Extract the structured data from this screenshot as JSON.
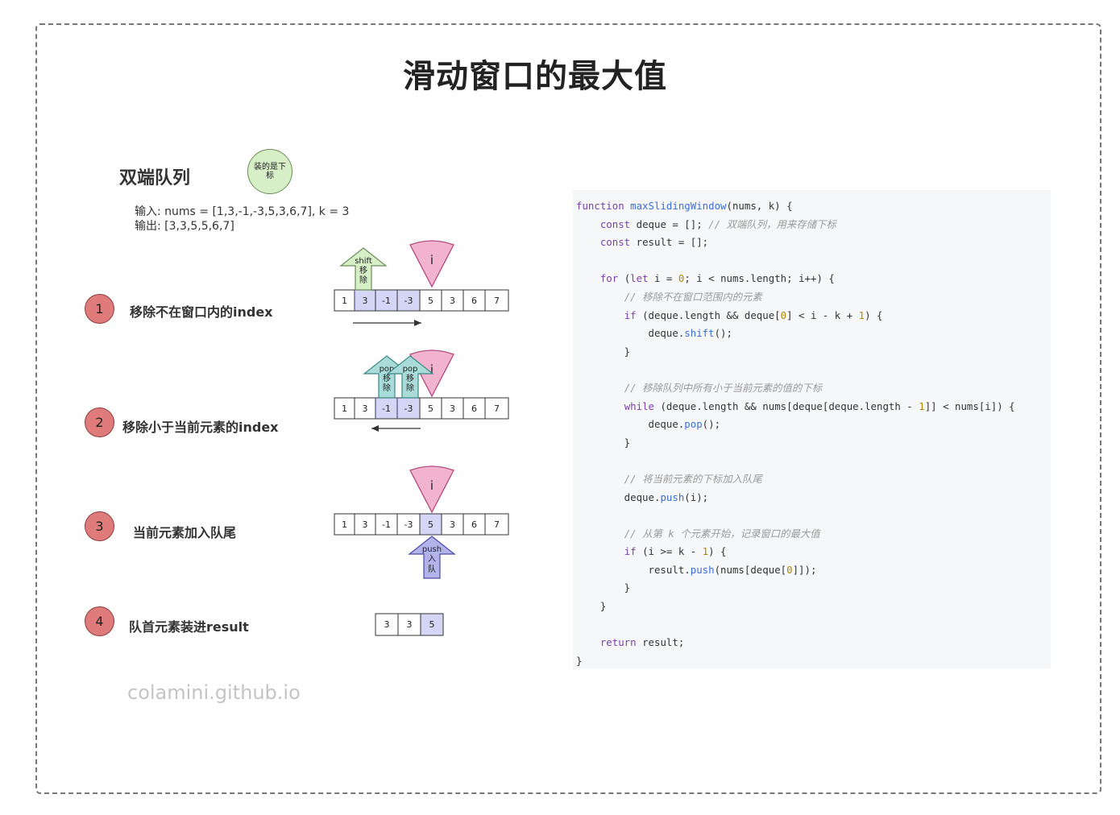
{
  "title": "滑动窗口的最大值",
  "subtitle": "双端队列",
  "badge": "装的是下标",
  "io": {
    "input": "输入: nums = [1,3,-1,-3,5,3,6,7], k = 3",
    "output": "输出: [3,3,5,5,6,7]"
  },
  "steps": [
    {
      "num": "1",
      "label": "移除不在窗口内的index"
    },
    {
      "num": "2",
      "label": "移除小于当前元素的index"
    },
    {
      "num": "3",
      "label": "当前元素加入队尾"
    },
    {
      "num": "4",
      "label": "队首元素装进result"
    }
  ],
  "array": [
    "1",
    "3",
    "-1",
    "-3",
    "5",
    "3",
    "6",
    "7"
  ],
  "pointer_label": "i",
  "arrows": {
    "shift": [
      "shift",
      "移",
      "除"
    ],
    "pop": [
      "pop",
      "移",
      "除"
    ],
    "push": [
      "push",
      "入",
      "队"
    ]
  },
  "result_cells": [
    "3",
    "3",
    "5"
  ],
  "watermark": "colamini.github.io",
  "colors": {
    "step_circle": "#e07b7b",
    "highlight": "#d5d5f5",
    "pointer": "#f2b3cf",
    "shift_arrow": "#d6efc6",
    "pop_arrow": "#a9dbd8",
    "push_arrow": "#b3b3ec"
  },
  "code": [
    [
      [
        "kw",
        "function "
      ],
      [
        "fn",
        "maxSlidingWindow"
      ],
      [
        "p",
        "(nums, k) {"
      ]
    ],
    [
      [
        "p",
        "    "
      ],
      [
        "kw",
        "const"
      ],
      [
        "p",
        " deque = []; "
      ],
      [
        "com",
        "// 双端队列，用来存储下标"
      ]
    ],
    [
      [
        "p",
        "    "
      ],
      [
        "kw",
        "const"
      ],
      [
        "p",
        " result = [];"
      ]
    ],
    [
      [
        "p",
        ""
      ]
    ],
    [
      [
        "p",
        "    "
      ],
      [
        "kw",
        "for"
      ],
      [
        "p",
        " ("
      ],
      [
        "kw",
        "let"
      ],
      [
        "p",
        " i = "
      ],
      [
        "num",
        "0"
      ],
      [
        "p",
        "; i < nums.length; i++) {"
      ]
    ],
    [
      [
        "p",
        "        "
      ],
      [
        "com",
        "// 移除不在窗口范围内的元素"
      ]
    ],
    [
      [
        "p",
        "        "
      ],
      [
        "kw",
        "if"
      ],
      [
        "p",
        " (deque.length && deque["
      ],
      [
        "num",
        "0"
      ],
      [
        "p",
        "] < i - k + "
      ],
      [
        "num",
        "1"
      ],
      [
        "p",
        ") {"
      ]
    ],
    [
      [
        "p",
        "            deque."
      ],
      [
        "fn",
        "shift"
      ],
      [
        "p",
        "();"
      ]
    ],
    [
      [
        "p",
        "        }"
      ]
    ],
    [
      [
        "p",
        ""
      ]
    ],
    [
      [
        "p",
        "        "
      ],
      [
        "com",
        "// 移除队列中所有小于当前元素的值的下标"
      ]
    ],
    [
      [
        "p",
        "        "
      ],
      [
        "kw",
        "while"
      ],
      [
        "p",
        " (deque.length && nums[deque[deque.length - "
      ],
      [
        "num",
        "1"
      ],
      [
        "p",
        "]] < nums[i]) {"
      ]
    ],
    [
      [
        "p",
        "            deque."
      ],
      [
        "fn",
        "pop"
      ],
      [
        "p",
        "();"
      ]
    ],
    [
      [
        "p",
        "        }"
      ]
    ],
    [
      [
        "p",
        ""
      ]
    ],
    [
      [
        "p",
        "        "
      ],
      [
        "com",
        "// 将当前元素的下标加入队尾"
      ]
    ],
    [
      [
        "p",
        "        deque."
      ],
      [
        "fn",
        "push"
      ],
      [
        "p",
        "(i);"
      ]
    ],
    [
      [
        "p",
        ""
      ]
    ],
    [
      [
        "p",
        "        "
      ],
      [
        "com",
        "// 从第 k 个元素开始，记录窗口的最大值"
      ]
    ],
    [
      [
        "p",
        "        "
      ],
      [
        "kw",
        "if"
      ],
      [
        "p",
        " (i >= k - "
      ],
      [
        "num",
        "1"
      ],
      [
        "p",
        ") {"
      ]
    ],
    [
      [
        "p",
        "            result."
      ],
      [
        "fn",
        "push"
      ],
      [
        "p",
        "(nums[deque["
      ],
      [
        "num",
        "0"
      ],
      [
        "p",
        "]]);"
      ]
    ],
    [
      [
        "p",
        "        }"
      ]
    ],
    [
      [
        "p",
        "    }"
      ]
    ],
    [
      [
        "p",
        ""
      ]
    ],
    [
      [
        "p",
        "    "
      ],
      [
        "kw",
        "return"
      ],
      [
        "p",
        " result;"
      ]
    ],
    [
      [
        "p",
        "}"
      ]
    ]
  ]
}
